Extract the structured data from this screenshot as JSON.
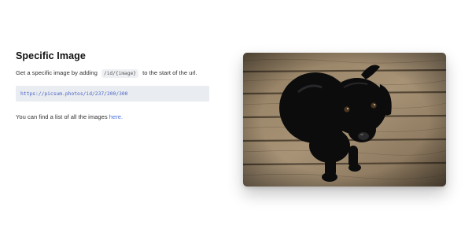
{
  "section": {
    "title": "Specific Image",
    "desc_before": "Get a specific image by adding",
    "code": "/id/{image}",
    "desc_after": "to the start of the url.",
    "example_url": "https://picsum.photos/id/237/200/300",
    "list_text": "You can find a list of all the images",
    "list_link": "here."
  },
  "image": {
    "icon": "black-labrador-puppy-photo"
  },
  "colors": {
    "link": "#4a6fd8",
    "code_text": "#4a64c8",
    "code_bg": "#e9ecf0"
  }
}
